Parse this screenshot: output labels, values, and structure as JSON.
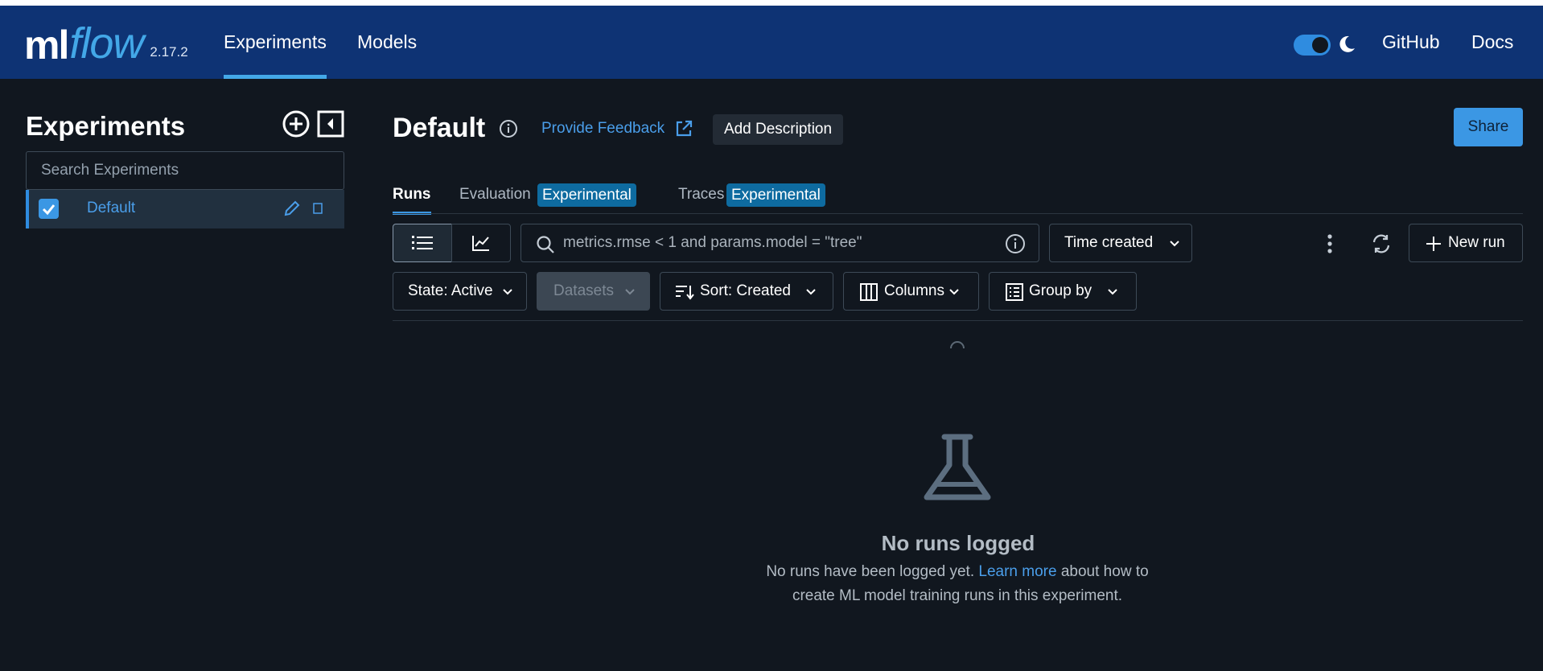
{
  "header": {
    "logo_ml": "ml",
    "logo_flow": "flow",
    "version": "2.17.2",
    "nav": [
      {
        "label": "Experiments",
        "active": true
      },
      {
        "label": "Models",
        "active": false
      }
    ],
    "dark_mode_toggle": "on",
    "links": [
      "GitHub",
      "Docs"
    ]
  },
  "sidebar": {
    "title": "Experiments",
    "search_placeholder": "Search Experiments",
    "experiments": [
      {
        "name": "Default",
        "checked": true
      }
    ]
  },
  "main": {
    "title": "Default",
    "feedback_label": "Provide Feedback",
    "add_description_label": "Add Description",
    "share_label": "Share",
    "tabs": [
      {
        "label": "Runs",
        "active": true,
        "badge": ""
      },
      {
        "label": "Evaluation",
        "active": false,
        "badge": "Experimental"
      },
      {
        "label": "Traces",
        "active": false,
        "badge": "Experimental"
      }
    ],
    "search_placeholder": "metrics.rmse < 1 and params.model = \"tree\"",
    "time_created_label": "Time created",
    "new_run_label": "New run",
    "filters": {
      "state_label": "State: Active",
      "datasets_label": "Datasets",
      "sort_label": "Sort: Created",
      "columns_label": "Columns",
      "group_by_label": "Group by"
    },
    "empty_state": {
      "title": "No runs logged",
      "desc_before": "No runs have been logged yet.",
      "link": "Learn more",
      "desc_after": "about how to create ML model training runs in this experiment."
    }
  },
  "colors": {
    "header_bg": "#0e3374",
    "page_bg": "#11171f",
    "accent": "#3b97e4",
    "badge_bg": "#0e6ba0"
  }
}
